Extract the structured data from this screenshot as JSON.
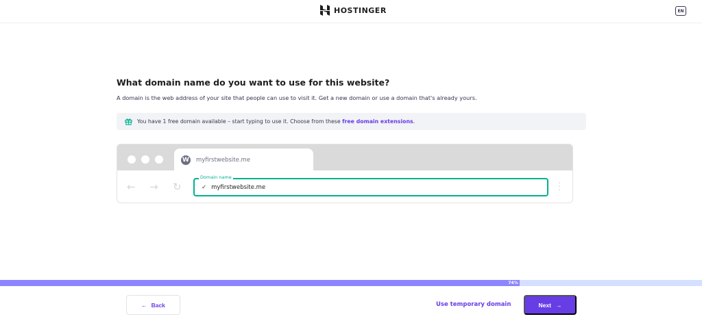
{
  "header": {
    "brand": "HOSTINGER",
    "language": "EN"
  },
  "main": {
    "title": "What domain name do you want to use for this website?",
    "subtitle": "A domain is the web address of your site that people can use to visit it. Get a new domain or use a domain that's already yours.",
    "info_text": "You have 1 free domain available – start typing to use it. Choose from these",
    "info_link": "free domain extensions",
    "info_end": ".",
    "browser": {
      "tab_title": "myfirstwebsite.me",
      "field_label": "Domain name",
      "field_value": "myfirstwebsite.me"
    }
  },
  "progress": {
    "percent": 74,
    "label": "74%"
  },
  "footer": {
    "back": "Back",
    "temporary": "Use temporary domain",
    "next": "Next"
  },
  "colors": {
    "accent": "#673de6",
    "success": "#00b090",
    "progress_fill": "#8c85ff",
    "progress_track": "#d5dfff"
  }
}
